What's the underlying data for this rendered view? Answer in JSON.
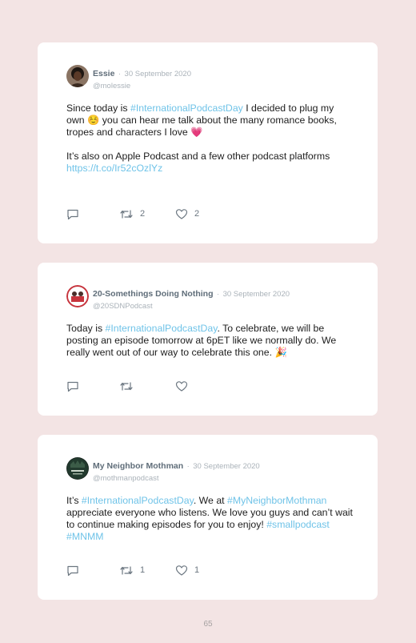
{
  "tweets": [
    {
      "name": "Essie",
      "separator": "·",
      "date": "30 September 2020",
      "handle": "@molessie",
      "body": {
        "p1_a": "Since today is ",
        "p1_tag": "#InternationalPodcastDay",
        "p1_b": " I decided to plug my own ",
        "emoji1": "☺️",
        "p1_c": " you can hear me talk about the many romance books, tropes and characters I love ",
        "emoji2": "💗",
        "p2": "It’s also on Apple Podcast and a few other podcast platforms",
        "link": "https://t.co/Ir52cOzlYz"
      },
      "retweets": "2",
      "likes": "2"
    },
    {
      "name": "20-Somethings Doing Nothing",
      "separator": "·",
      "date": "30 September 2020",
      "handle": "@20SDNPodcast",
      "body": {
        "a": "Today is ",
        "tag": "#InternationalPodcastDay",
        "b": ". To celebrate, we will be posting an episode tomorrow at 6pET like we normally do. We really went out of our way to celebrate this one. ",
        "emoji": "🎉"
      },
      "retweets": "",
      "likes": ""
    },
    {
      "name": "My Neighbor Mothman",
      "separator": "·",
      "date": "30 September 2020",
      "handle": "@mothmanpodcast",
      "body": {
        "a": "It’s ",
        "tag1": "#InternationalPodcastDay",
        "b": ". We at ",
        "tag2": "#MyNeighborMothman",
        "c": " appreciate everyone who listens. We love you guys and can’t wait to continue making episodes for you to enjoy! ",
        "tag3": "#smallpodcast",
        "space": " ",
        "tag4": "#MNMM"
      },
      "retweets": "1",
      "likes": "1"
    }
  ],
  "icons": {
    "reply": "reply-icon",
    "retweet": "retweet-icon",
    "like": "heart-icon"
  },
  "colors": {
    "page_background": "#f3e4e4",
    "card": "#ffffff",
    "hashtag_link": "#6fc3e8",
    "name": "#5f6d79",
    "muted": "#aab2b9"
  },
  "page_number": "65"
}
